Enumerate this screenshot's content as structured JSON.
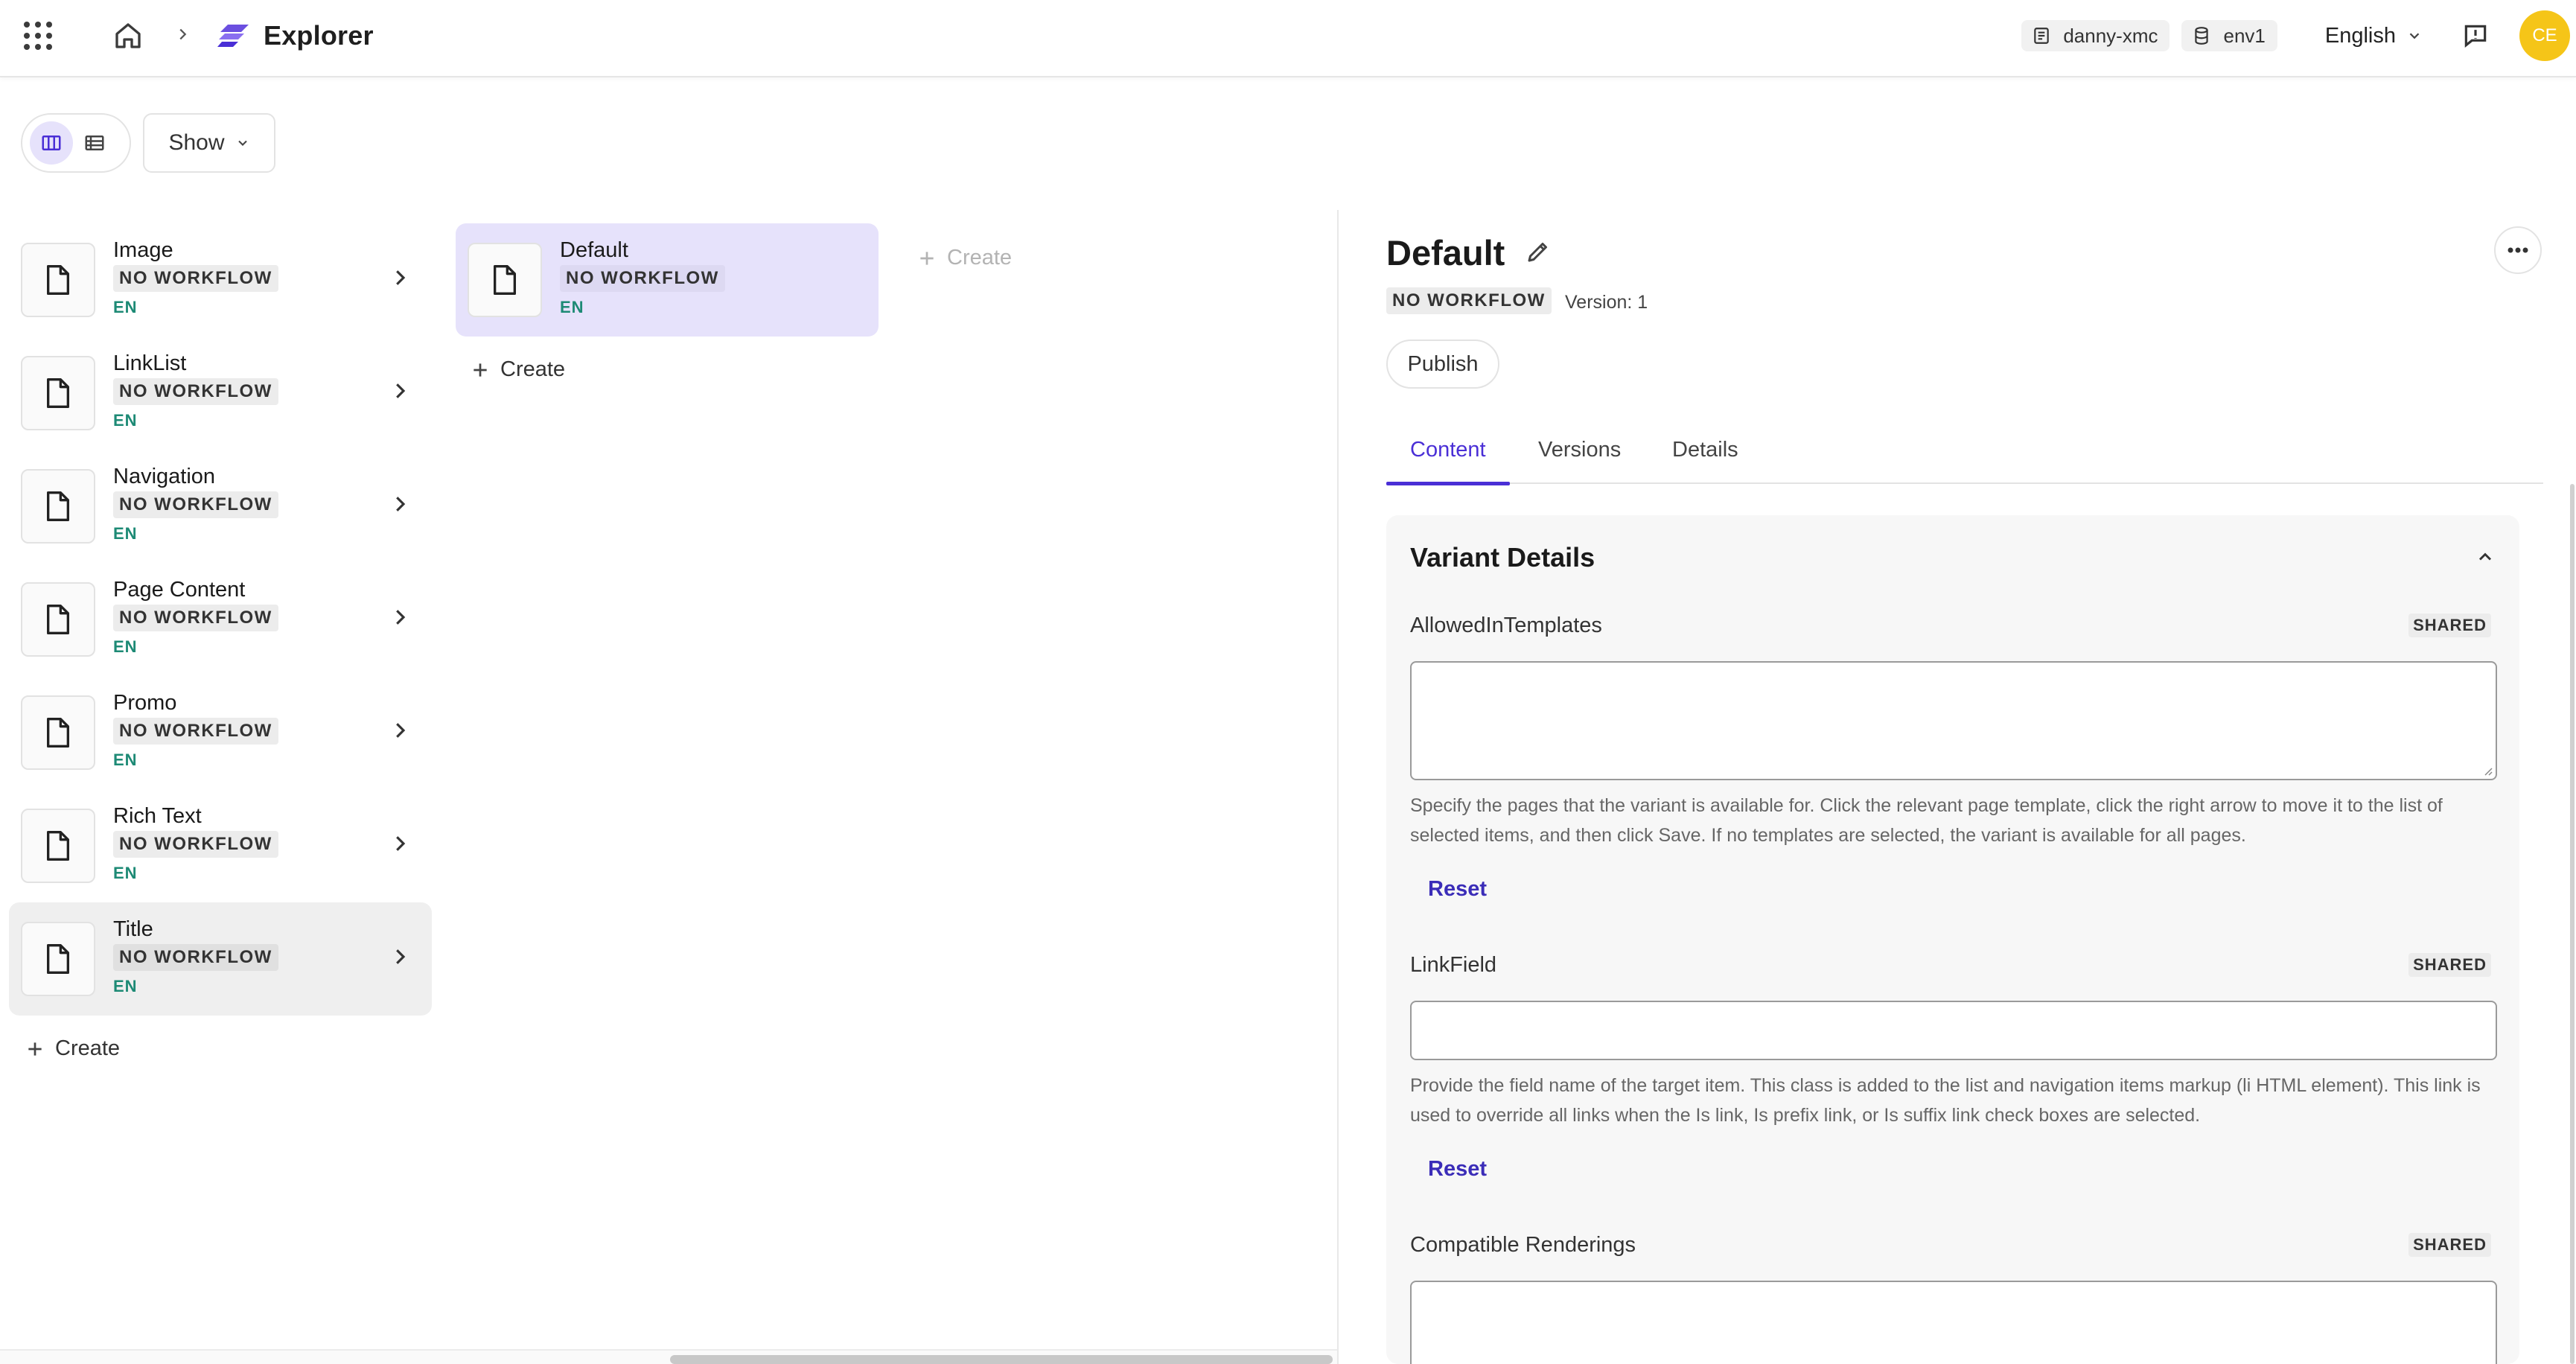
{
  "app": {
    "title": "Explorer"
  },
  "header": {
    "site_chip": "danny-xmc",
    "env_chip": "env1",
    "language": "English",
    "avatar_initials": "CE"
  },
  "toolbar": {
    "show_label": "Show"
  },
  "column1": {
    "items": [
      {
        "name": "Image",
        "workflow": "NO WORKFLOW",
        "lang": "EN"
      },
      {
        "name": "LinkList",
        "workflow": "NO WORKFLOW",
        "lang": "EN"
      },
      {
        "name": "Navigation",
        "workflow": "NO WORKFLOW",
        "lang": "EN"
      },
      {
        "name": "Page Content",
        "workflow": "NO WORKFLOW",
        "lang": "EN"
      },
      {
        "name": "Promo",
        "workflow": "NO WORKFLOW",
        "lang": "EN"
      },
      {
        "name": "Rich Text",
        "workflow": "NO WORKFLOW",
        "lang": "EN"
      },
      {
        "name": "Title",
        "workflow": "NO WORKFLOW",
        "lang": "EN"
      }
    ],
    "create_label": "Create"
  },
  "column2": {
    "items": [
      {
        "name": "Default",
        "workflow": "NO WORKFLOW",
        "lang": "EN"
      }
    ],
    "create_label": "Create"
  },
  "column3": {
    "create_label": "Create"
  },
  "details": {
    "title": "Default",
    "workflow": "NO WORKFLOW",
    "version": "Version: 1",
    "publish_label": "Publish",
    "tabs": [
      "Content",
      "Versions",
      "Details"
    ],
    "section_title": "Variant Details",
    "fields": [
      {
        "label": "AllowedInTemplates",
        "tag": "SHARED",
        "value": "",
        "help": "Specify the pages that the variant is available for. Click the relevant page template, click the right arrow to move it to the list of selected items, and then click Save. If no templates are selected, the variant is available for all pages.",
        "reset_label": "Reset"
      },
      {
        "label": "LinkField",
        "tag": "SHARED",
        "value": "",
        "help": "Provide the field name of the target item. This class is added to the list and navigation items markup (li HTML element). This link is used to override all links when the Is link, Is prefix link, or Is suffix link check boxes are selected.",
        "reset_label": "Reset"
      },
      {
        "label": "Compatible Renderings",
        "tag": "SHARED",
        "value": ""
      }
    ]
  },
  "colors": {
    "accent": "#4a2fd6",
    "selected_bg": "#e6e2fb",
    "lang_code": "#1d8a75",
    "avatar": "#f5c518"
  }
}
